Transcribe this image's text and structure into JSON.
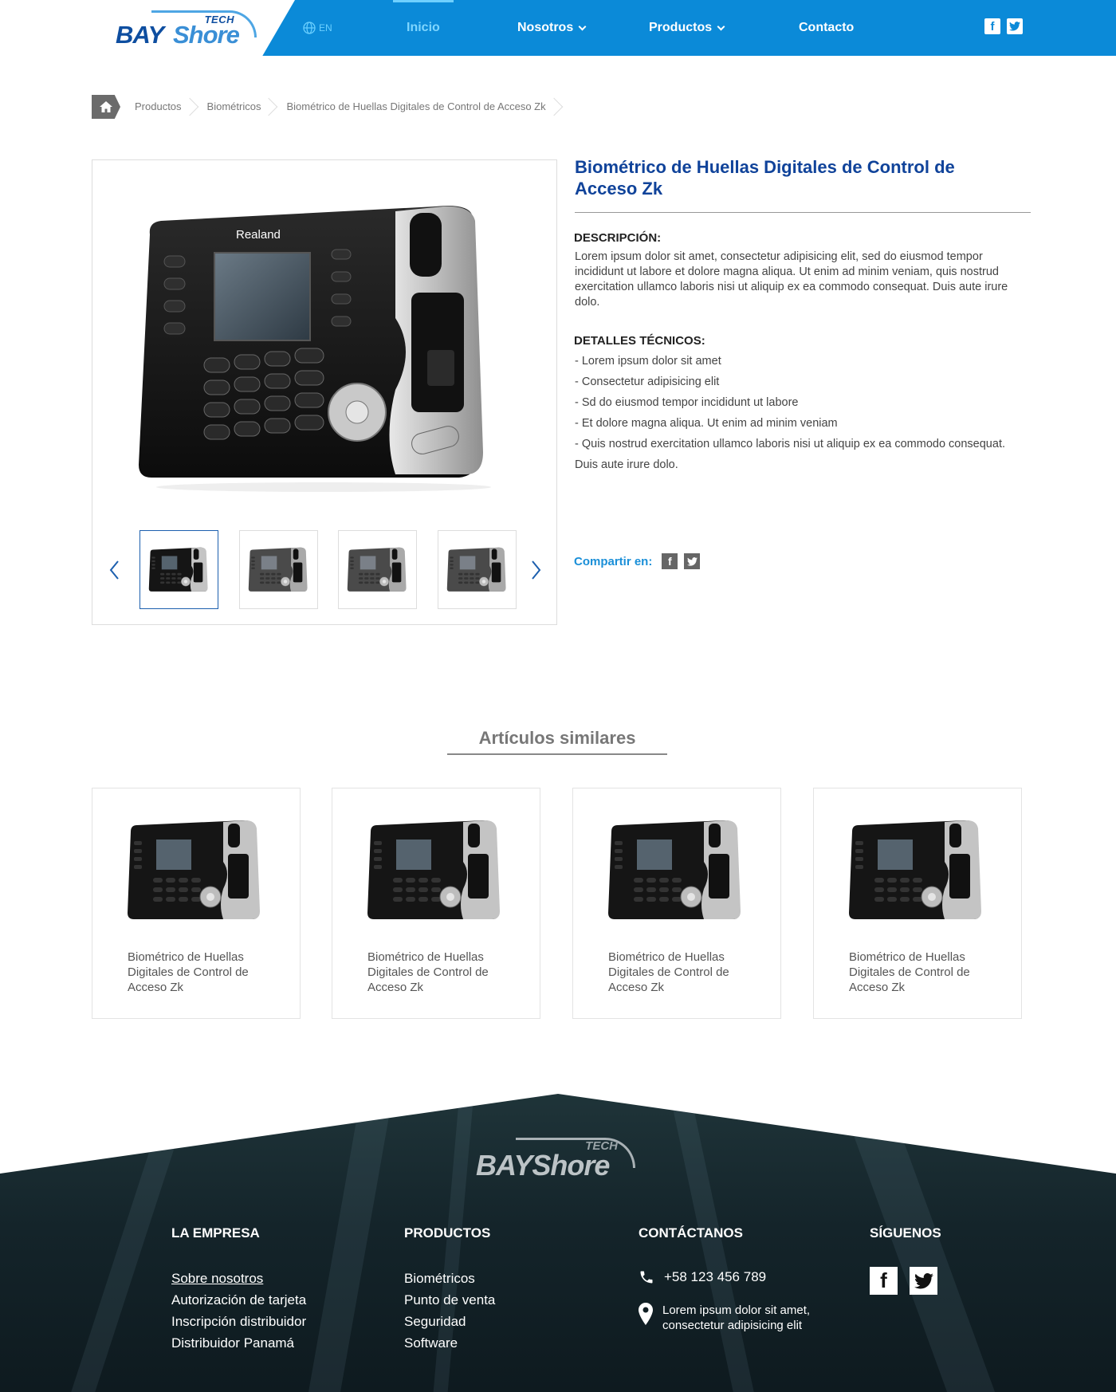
{
  "brand": {
    "word1": "BAY",
    "word2": "Shore",
    "tag": "TECH"
  },
  "header": {
    "lang": "EN",
    "nav": [
      {
        "label": "Inicio"
      },
      {
        "label": "Nosotros"
      },
      {
        "label": "Productos"
      },
      {
        "label": "Contacto"
      }
    ],
    "social": [
      "facebook-icon",
      "twitter-icon"
    ]
  },
  "breadcrumb": [
    "Productos",
    "Biométricos",
    "Biométrico de Huellas Digitales de Control de Acceso Zk"
  ],
  "product": {
    "title": "Biométrico de Huellas Digitales de Control de Acceso Zk",
    "device_brand": "Realand",
    "description_heading": "DESCRIPCIÓN:",
    "description": "Lorem ipsum dolor sit amet, consectetur adipisicing elit, sed do eiusmod tempor incididunt ut labore et dolore magna aliqua. Ut enim ad minim veniam, quis nostrud exercitation ullamco laboris nisi ut aliquip ex ea commodo consequat. Duis aute irure dolo.",
    "details_heading": "DETALLES TÉCNICOS:",
    "details": [
      "- Lorem ipsum dolor sit amet",
      "- Consectetur adipisicing elit",
      "- Sd do eiusmod tempor incididunt ut labore",
      "- Et dolore magna aliqua. Ut enim ad minim veniam",
      "- Quis nostrud exercitation ullamco laboris nisi ut aliquip ex ea commodo consequat. Duis aute irure dolo."
    ],
    "share_label": "Compartir en:",
    "thumbnail_count": 4
  },
  "similar": {
    "title": "Artículos similares",
    "items": [
      {
        "name": "Biométrico de Huellas Digitales de Control de Acceso Zk"
      },
      {
        "name": "Biométrico de Huellas Digitales de Control de Acceso Zk"
      },
      {
        "name": "Biométrico de Huellas Digitales de Control de Acceso Zk"
      },
      {
        "name": "Biométrico de Huellas Digitales de Control de Acceso Zk"
      }
    ]
  },
  "footer": {
    "company": {
      "heading": "LA EMPRESA",
      "links": [
        "Sobre nosotros",
        "Autorización de tarjeta",
        "Inscripción distribuidor",
        "Distribuidor Panamá"
      ]
    },
    "products": {
      "heading": "PRODUCTOS",
      "links": [
        "Biométricos",
        "Punto de venta",
        "Seguridad",
        "Software"
      ]
    },
    "contact": {
      "heading": "CONTÁCTANOS",
      "phone": "+58 123 456 789",
      "address": "Lorem ipsum dolor sit amet, consectetur adipisicing elit"
    },
    "follow": {
      "heading": "SÍGUENOS"
    }
  },
  "colors": {
    "primary_blue": "#0b8ad8",
    "title_blue": "#10439a",
    "footer_dark": "#14242a"
  }
}
